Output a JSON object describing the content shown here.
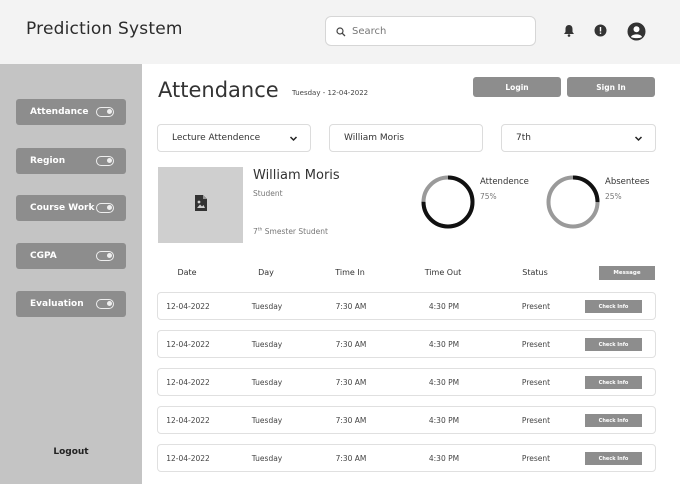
{
  "header": {
    "app_title": "Prediction System",
    "search_placeholder": "Search",
    "icons": [
      "bell-icon",
      "alert-icon",
      "user-account-icon"
    ]
  },
  "sidebar": {
    "items": [
      {
        "label": "Attendance",
        "icon": "toggle-icon"
      },
      {
        "label": "Region",
        "icon": "toggle-icon"
      },
      {
        "label": "Course Work",
        "icon": "toggle-icon"
      },
      {
        "label": "CGPA",
        "icon": "toggle-icon"
      },
      {
        "label": "Evaluation",
        "icon": "toggle-icon"
      }
    ],
    "logout_label": "Logout"
  },
  "main": {
    "title": "Attendance",
    "date": "Tuesday - 12-04-2022",
    "login_label": "Login",
    "signin_label": "Sign In",
    "filters": {
      "lecture": "Lecture Attendence",
      "student": "William Moris",
      "semester": "7th"
    },
    "student": {
      "name": "William Moris",
      "role": "Student",
      "semester_num": "7",
      "semester_sup": "th",
      "semester_rest": " Smester Student",
      "image_icon": "image-placeholder-icon"
    },
    "stats": {
      "attendance_label": "Attendence",
      "attendance_pct": "75%",
      "attendance_value": 0.75,
      "absentees_label": "Absentees",
      "absentees_pct": "25%",
      "absentees_value": 0.25
    },
    "table": {
      "headers": [
        "Date",
        "Day",
        "Time In",
        "Time Out",
        "Status"
      ],
      "message_label": "Message",
      "action_label": "Check Info",
      "rows": [
        {
          "date": "12-04-2022",
          "day": "Tuesday",
          "time_in": "7:30 AM",
          "time_out": "4:30 PM",
          "status": "Present"
        },
        {
          "date": "12-04-2022",
          "day": "Tuesday",
          "time_in": "7:30 AM",
          "time_out": "4:30 PM",
          "status": "Present"
        },
        {
          "date": "12-04-2022",
          "day": "Tuesday",
          "time_in": "7:30 AM",
          "time_out": "4:30 PM",
          "status": "Present"
        },
        {
          "date": "12-04-2022",
          "day": "Tuesday",
          "time_in": "7:30 AM",
          "time_out": "4:30 PM",
          "status": "Present"
        },
        {
          "date": "12-04-2022",
          "day": "Tuesday",
          "time_in": "7:30 AM",
          "time_out": "4:30 PM",
          "status": "Present"
        }
      ]
    }
  }
}
